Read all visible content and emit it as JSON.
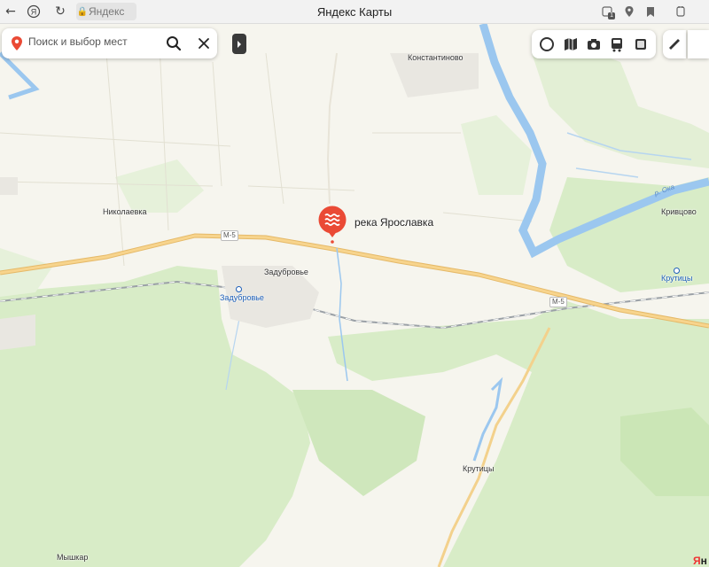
{
  "browser": {
    "address_host": "Яндекс",
    "page_title": "Яндекс Карты",
    "extension_badge": "1"
  },
  "search": {
    "placeholder": "Поиск и выбор мест"
  },
  "poi": {
    "name": "река Ярославка"
  },
  "places": {
    "konstantinovo": "Константиново",
    "nikolaevka": "Николаевка",
    "zadubrovie": "Задубровье",
    "krivtsovo": "Кривцово",
    "krutitsy": "Крутицы",
    "myshkar": "Мышкар"
  },
  "stations": {
    "zadubrovie": "Задубровье",
    "krutitsy": "Крутицы"
  },
  "roads": {
    "m5_west": "М-5",
    "m5_east": "М-5"
  },
  "rivers": {
    "oka": "р. Ока"
  },
  "logo": {
    "text_a": "Я",
    "text_b": "н"
  },
  "colors": {
    "forest": "#d8ecc7",
    "forest_dark": "#c9e4b3",
    "land": "#f6f5ee",
    "road_main": "#f5d38a",
    "river": "#9bc7ef",
    "poi_red": "#ea4a35",
    "station": "#1d5fb8"
  }
}
